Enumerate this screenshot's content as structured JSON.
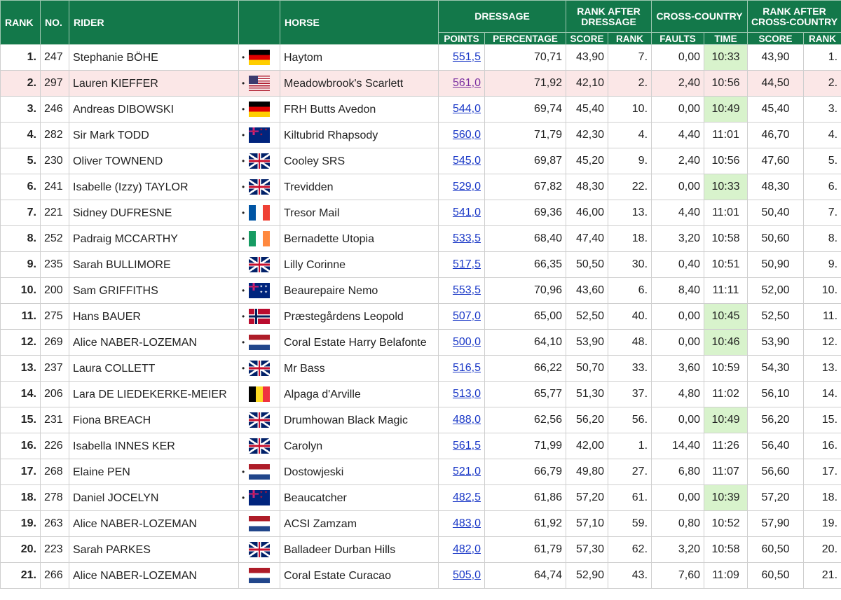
{
  "headers": {
    "rank": "RANK",
    "no": "NO.",
    "rider": "RIDER",
    "horse": "HORSE",
    "dressage": "DRESSAGE",
    "rank_after_dressage": "RANK AFTER DRESSAGE",
    "cross_country": "CROSS-COUNTRY",
    "rank_after_cross_country": "RANK AFTER CROSS-COUNTRY",
    "points": "POINTS",
    "percentage": "PERCENTAGE",
    "score": "SCORE",
    "rank_sub": "RANK",
    "faults": "FAULTS",
    "time": "TIME",
    "score2": "SCORE",
    "rank_sub2": "RANK"
  },
  "colors": {
    "header_green": "#13784a",
    "fast_time": "#d8f3cc",
    "highlight_row": "#fbe7e7",
    "link_blue": "#1a38c7"
  },
  "rows": [
    {
      "rank": "1.",
      "no": "247",
      "rider": "Stephanie BÖHE",
      "dot": "•",
      "flag": "ger",
      "horse": "Haytom",
      "points": "551,5",
      "pct": "70,71",
      "d_score": "43,90",
      "d_rank": "7.",
      "faults": "0,00",
      "time": "10:33",
      "fast": true,
      "score": "43,90",
      "rank2": "1.",
      "hl": false
    },
    {
      "rank": "2.",
      "no": "297",
      "rider": "Lauren KIEFFER",
      "dot": "•",
      "flag": "usa",
      "horse": "Meadowbrook's Scarlett",
      "points": "561,0",
      "pct": "71,92",
      "d_score": "42,10",
      "d_rank": "2.",
      "faults": "2,40",
      "time": "10:56",
      "fast": false,
      "score": "44,50",
      "rank2": "2.",
      "hl": true
    },
    {
      "rank": "3.",
      "no": "246",
      "rider": "Andreas DIBOWSKI",
      "dot": "•",
      "flag": "ger",
      "horse": "FRH Butts Avedon",
      "points": "544,0",
      "pct": "69,74",
      "d_score": "45,40",
      "d_rank": "10.",
      "faults": "0,00",
      "time": "10:49",
      "fast": true,
      "score": "45,40",
      "rank2": "3.",
      "hl": false
    },
    {
      "rank": "4.",
      "no": "282",
      "rider": "Sir Mark TODD",
      "dot": "•",
      "flag": "nzl",
      "horse": "Kiltubrid Rhapsody",
      "points": "560,0",
      "pct": "71,79",
      "d_score": "42,30",
      "d_rank": "4.",
      "faults": "4,40",
      "time": "11:01",
      "fast": false,
      "score": "46,70",
      "rank2": "4.",
      "hl": false
    },
    {
      "rank": "5.",
      "no": "230",
      "rider": "Oliver TOWNEND",
      "dot": "•",
      "flag": "gbr",
      "horse": "Cooley SRS",
      "points": "545,0",
      "pct": "69,87",
      "d_score": "45,20",
      "d_rank": "9.",
      "faults": "2,40",
      "time": "10:56",
      "fast": false,
      "score": "47,60",
      "rank2": "5.",
      "hl": false
    },
    {
      "rank": "6.",
      "no": "241",
      "rider": "Isabelle (Izzy) TAYLOR",
      "dot": "•",
      "flag": "gbr",
      "horse": "Trevidden",
      "points": "529,0",
      "pct": "67,82",
      "d_score": "48,30",
      "d_rank": "22.",
      "faults": "0,00",
      "time": "10:33",
      "fast": true,
      "score": "48,30",
      "rank2": "6.",
      "hl": false
    },
    {
      "rank": "7.",
      "no": "221",
      "rider": "Sidney DUFRESNE",
      "dot": "•",
      "flag": "fra",
      "horse": "Tresor Mail",
      "points": "541,0",
      "pct": "69,36",
      "d_score": "46,00",
      "d_rank": "13.",
      "faults": "4,40",
      "time": "11:01",
      "fast": false,
      "score": "50,40",
      "rank2": "7.",
      "hl": false
    },
    {
      "rank": "8.",
      "no": "252",
      "rider": "Padraig MCCARTHY",
      "dot": "•",
      "flag": "irl",
      "horse": "Bernadette Utopia",
      "points": "533,5",
      "pct": "68,40",
      "d_score": "47,40",
      "d_rank": "18.",
      "faults": "3,20",
      "time": "10:58",
      "fast": false,
      "score": "50,60",
      "rank2": "8.",
      "hl": false
    },
    {
      "rank": "9.",
      "no": "235",
      "rider": "Sarah BULLIMORE",
      "dot": "",
      "flag": "gbr",
      "horse": "Lilly Corinne",
      "points": "517,5",
      "pct": "66,35",
      "d_score": "50,50",
      "d_rank": "30.",
      "faults": "0,40",
      "time": "10:51",
      "fast": false,
      "score": "50,90",
      "rank2": "9.",
      "hl": false
    },
    {
      "rank": "10.",
      "no": "200",
      "rider": "Sam GRIFFITHS",
      "dot": "•",
      "flag": "aus",
      "horse": "Beaurepaire Nemo",
      "points": "553,5",
      "pct": "70,96",
      "d_score": "43,60",
      "d_rank": "6.",
      "faults": "8,40",
      "time": "11:11",
      "fast": false,
      "score": "52,00",
      "rank2": "10.",
      "hl": false
    },
    {
      "rank": "11.",
      "no": "275",
      "rider": "Hans BAUER",
      "dot": "•",
      "flag": "nor",
      "horse": "Præstegårdens Leopold",
      "points": "507,0",
      "pct": "65,00",
      "d_score": "52,50",
      "d_rank": "40.",
      "faults": "0,00",
      "time": "10:45",
      "fast": true,
      "score": "52,50",
      "rank2": "11.",
      "hl": false
    },
    {
      "rank": "12.",
      "no": "269",
      "rider": "Alice NABER-LOZEMAN",
      "dot": "•",
      "flag": "ned",
      "horse": "Coral Estate Harry Belafonte",
      "points": "500,0",
      "pct": "64,10",
      "d_score": "53,90",
      "d_rank": "48.",
      "faults": "0,00",
      "time": "10:46",
      "fast": true,
      "score": "53,90",
      "rank2": "12.",
      "hl": false
    },
    {
      "rank": "13.",
      "no": "237",
      "rider": "Laura COLLETT",
      "dot": "•",
      "flag": "gbr",
      "horse": "Mr Bass",
      "points": "516,5",
      "pct": "66,22",
      "d_score": "50,70",
      "d_rank": "33.",
      "faults": "3,60",
      "time": "10:59",
      "fast": false,
      "score": "54,30",
      "rank2": "13.",
      "hl": false
    },
    {
      "rank": "14.",
      "no": "206",
      "rider": "Lara DE LIEDEKERKE-MEIER",
      "dot": "",
      "flag": "bel",
      "horse": "Alpaga d'Arville",
      "points": "513,0",
      "pct": "65,77",
      "d_score": "51,30",
      "d_rank": "37.",
      "faults": "4,80",
      "time": "11:02",
      "fast": false,
      "score": "56,10",
      "rank2": "14.",
      "hl": false
    },
    {
      "rank": "15.",
      "no": "231",
      "rider": "Fiona BREACH",
      "dot": "",
      "flag": "gbr",
      "horse": "Drumhowan Black Magic",
      "points": "488,0",
      "pct": "62,56",
      "d_score": "56,20",
      "d_rank": "56.",
      "faults": "0,00",
      "time": "10:49",
      "fast": true,
      "score": "56,20",
      "rank2": "15.",
      "hl": false
    },
    {
      "rank": "16.",
      "no": "226",
      "rider": "Isabella INNES KER",
      "dot": "",
      "flag": "gbr",
      "horse": "Carolyn",
      "points": "561,5",
      "pct": "71,99",
      "d_score": "42,00",
      "d_rank": "1.",
      "faults": "14,40",
      "time": "11:26",
      "fast": false,
      "score": "56,40",
      "rank2": "16.",
      "hl": false
    },
    {
      "rank": "17.",
      "no": "268",
      "rider": "Elaine PEN",
      "dot": "•",
      "flag": "ned",
      "horse": "Dostowjeski",
      "points": "521,0",
      "pct": "66,79",
      "d_score": "49,80",
      "d_rank": "27.",
      "faults": "6,80",
      "time": "11:07",
      "fast": false,
      "score": "56,60",
      "rank2": "17.",
      "hl": false
    },
    {
      "rank": "18.",
      "no": "278",
      "rider": "Daniel JOCELYN",
      "dot": "•",
      "flag": "nzl",
      "horse": "Beaucatcher",
      "points": "482,5",
      "pct": "61,86",
      "d_score": "57,20",
      "d_rank": "61.",
      "faults": "0,00",
      "time": "10:39",
      "fast": true,
      "score": "57,20",
      "rank2": "18.",
      "hl": false
    },
    {
      "rank": "19.",
      "no": "263",
      "rider": "Alice NABER-LOZEMAN",
      "dot": "",
      "flag": "ned",
      "horse": "ACSI Zamzam",
      "points": "483,0",
      "pct": "61,92",
      "d_score": "57,10",
      "d_rank": "59.",
      "faults": "0,80",
      "time": "10:52",
      "fast": false,
      "score": "57,90",
      "rank2": "19.",
      "hl": false
    },
    {
      "rank": "20.",
      "no": "223",
      "rider": "Sarah PARKES",
      "dot": "",
      "flag": "gbr",
      "horse": "Balladeer Durban Hills",
      "points": "482,0",
      "pct": "61,79",
      "d_score": "57,30",
      "d_rank": "62.",
      "faults": "3,20",
      "time": "10:58",
      "fast": false,
      "score": "60,50",
      "rank2": "20.",
      "hl": false
    },
    {
      "rank": "21.",
      "no": "266",
      "rider": "Alice NABER-LOZEMAN",
      "dot": "",
      "flag": "ned",
      "horse": "Coral Estate Curacao",
      "points": "505,0",
      "pct": "64,74",
      "d_score": "52,90",
      "d_rank": "43.",
      "faults": "7,60",
      "time": "11:09",
      "fast": false,
      "score": "60,50",
      "rank2": "21.",
      "hl": false
    }
  ]
}
